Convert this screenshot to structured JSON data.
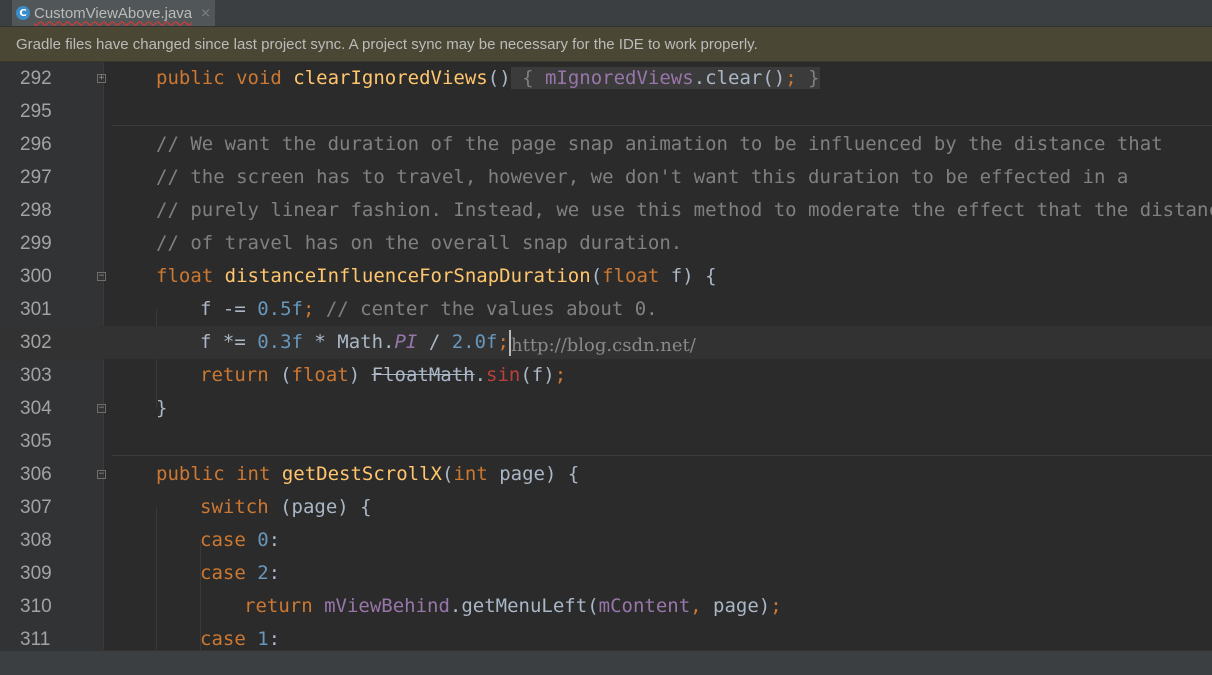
{
  "tab": {
    "icon_letter": "C",
    "title": "CustomViewAbove.java",
    "close": "×"
  },
  "banner": {
    "text": "Gradle files have changed since last project sync. A project sync may be necessary for the IDE to work properly."
  },
  "lines": {
    "l292": {
      "num": "292",
      "t1": "public void ",
      "t2": "clearIgnoredViews",
      "t3": "()",
      "t4": " { ",
      "t5": "mIgnoredViews",
      "t6": ".clear()",
      "t7": ";",
      "t8": " }"
    },
    "l295": {
      "num": "295"
    },
    "l296": {
      "num": "296",
      "c": "// We want the duration of the page snap animation to be influenced by the distance that"
    },
    "l297": {
      "num": "297",
      "c": "// the screen has to travel, however, we don't want this duration to be effected in a"
    },
    "l298": {
      "num": "298",
      "c": "// purely linear fashion. Instead, we use this method to moderate the effect that the distance"
    },
    "l299": {
      "num": "299",
      "c": "// of travel has on the overall snap duration."
    },
    "l300": {
      "num": "300",
      "t1": "float ",
      "t2": "distanceInfluenceForSnapDuration",
      "t3": "(",
      "t4": "float ",
      "t5": "f) {"
    },
    "l301": {
      "num": "301",
      "t1": "f -= ",
      "t2": "0.5f",
      "t3": "; ",
      "t4": "// center the values about 0."
    },
    "l302": {
      "num": "302",
      "t1": "f *= ",
      "t2": "0.3f",
      "t3": " * Math.",
      "t4": "PI",
      "t5": " / ",
      "t6": "2.0f",
      "t7": ";"
    },
    "l303": {
      "num": "303",
      "t1": "return ",
      "t2": "(",
      "t3": "float",
      "t4": ") ",
      "t5": "FloatMath",
      "t6": ".",
      "t7": "sin",
      "t8": "(f)",
      "t9": ";"
    },
    "l304": {
      "num": "304",
      "t1": "}"
    },
    "l305": {
      "num": "305"
    },
    "l306": {
      "num": "306",
      "t1": "public int ",
      "t2": "getDestScrollX",
      "t3": "(",
      "t4": "int ",
      "t5": "page) {"
    },
    "l307": {
      "num": "307",
      "t1": "switch ",
      "t2": "(page) {"
    },
    "l308": {
      "num": "308",
      "t1": "case ",
      "t2": "0",
      "t3": ":"
    },
    "l309": {
      "num": "309",
      "t1": "case ",
      "t2": "2",
      "t3": ":"
    },
    "l310": {
      "num": "310",
      "t1": "return ",
      "t2": "mViewBehind",
      "t3": ".getMenuLeft(",
      "t4": "mContent",
      "t5": ", ",
      "t6": "page)",
      "t7": ";"
    },
    "l311": {
      "num": "311",
      "t1": "case ",
      "t2": "1",
      "t3": ":"
    }
  },
  "watermark": "http://blog.csdn.net/",
  "colors": {
    "keyword": "#cc7832",
    "method": "#ffc66d",
    "field": "#9876aa",
    "number": "#6897bb",
    "comment": "#808080",
    "text": "#a9b7c6"
  }
}
